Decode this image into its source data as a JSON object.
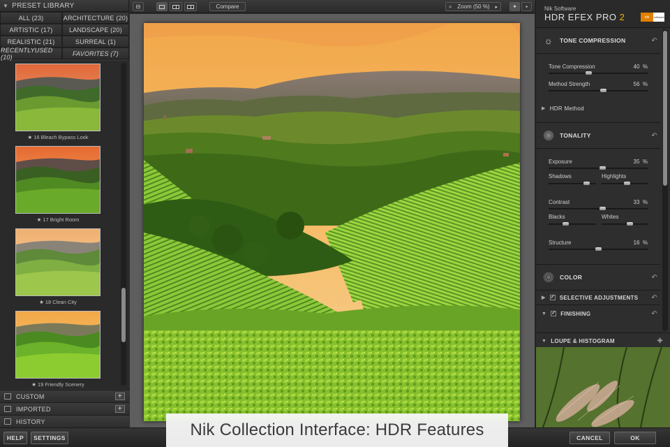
{
  "preset_library": {
    "title": "PRESET LIBRARY",
    "categories": [
      {
        "label": "ALL (23)"
      },
      {
        "label": "ARCHITECTURE (20)"
      },
      {
        "label": "ARTISTIC (17)"
      },
      {
        "label": "LANDSCAPE (20)"
      },
      {
        "label": "REALISTIC (21)"
      },
      {
        "label": "SURREAL (1)"
      },
      {
        "label": "RECENTLYUSED (10)"
      },
      {
        "label": "FAVORITES (7)"
      }
    ],
    "presets": [
      {
        "name": "16 Bleach Bypass Look"
      },
      {
        "name": "17 Bright Room"
      },
      {
        "name": "18 Clean City"
      },
      {
        "name": "19 Friendly Scenery"
      }
    ],
    "sections": [
      {
        "label": "CUSTOM"
      },
      {
        "label": "IMPORTED"
      },
      {
        "label": "HISTORY"
      }
    ]
  },
  "toolbar": {
    "compare_label": "Compare",
    "zoom_label": "Zoom (50 %)"
  },
  "brand": {
    "company": "Nik Software",
    "product": "HDR EFEX PRO",
    "version": "2"
  },
  "controls": {
    "tone_compression": {
      "title": "TONE COMPRESSION",
      "sliders": [
        {
          "label": "Tone Compression",
          "value": "40",
          "unit": "%",
          "level": 0.4
        },
        {
          "label": "Method Strength",
          "value": "56",
          "unit": "%",
          "level": 0.56
        }
      ],
      "method_label": "HDR Method"
    },
    "tonality": {
      "title": "TONALITY",
      "exposure": {
        "label": "Exposure",
        "value": "35",
        "unit": "%",
        "level": 0.55
      },
      "shadows_label": "Shadows",
      "highlights_label": "Highlights",
      "contrast": {
        "label": "Contrast",
        "value": "33",
        "unit": "%",
        "level": 0.55
      },
      "blacks_label": "Blacks",
      "whites_label": "Whites",
      "structure": {
        "label": "Structure",
        "value": "16",
        "unit": "%",
        "level": 0.5
      }
    },
    "color": {
      "title": "COLOR"
    },
    "selective": {
      "title": "SELECTIVE ADJUSTMENTS",
      "check": "✓"
    },
    "finishing": {
      "title": "FINISHING",
      "check": "✓"
    },
    "loupe": {
      "title": "LOUPE & HISTOGRAM"
    }
  },
  "bottom": {
    "help": "HELP",
    "settings": "SETTINGS",
    "cancel": "CANCEL",
    "ok": "OK"
  },
  "caption": "Nik Collection Interface: HDR Features",
  "colors": {
    "accent": "#f2b400",
    "panel": "#2e2e2e",
    "canvas": "#5e5e5e"
  }
}
